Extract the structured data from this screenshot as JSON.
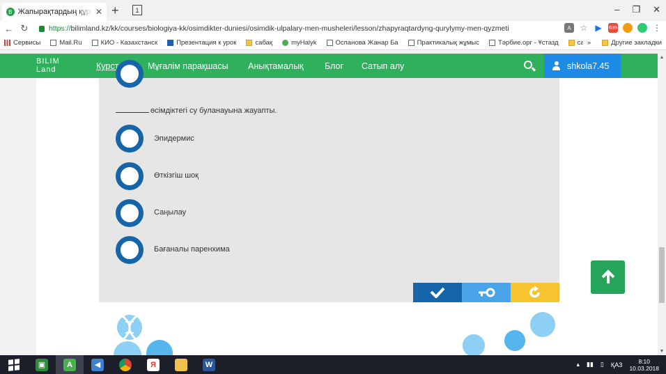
{
  "browser": {
    "tab_title": "Жапырақтардың құрылысы",
    "tab_count": "1",
    "url_scheme": "https://",
    "url_rest": "bilimland.kz/kk/courses/biologiya-kk/osimdikter-duniesi/osimdik-ulpalary-men-musheleri/lesson/zhapyraqtardyng-qurylymy-men-qyzmeti",
    "ext_badge": "639"
  },
  "bookmarks": {
    "items": [
      {
        "label": "Сервисы",
        "icon": "apps-icon"
      },
      {
        "label": "Mail.Ru",
        "icon": "page-icon"
      },
      {
        "label": "КИО - Казахстанск",
        "icon": "page-icon"
      },
      {
        "label": "Презентация к урок",
        "icon": "check-icon"
      },
      {
        "label": "сабақ",
        "icon": "folder-icon"
      },
      {
        "label": "myHalyk",
        "icon": "leaf-icon"
      },
      {
        "label": "Оспанова Жанар Ба",
        "icon": "page-icon"
      },
      {
        "label": "Практикалық жұмыс",
        "icon": "page-icon"
      },
      {
        "label": "Тәрбие.орг - Ұстазд",
        "icon": "page-icon"
      },
      {
        "label": "сад",
        "icon": "folder-icon"
      }
    ],
    "more": "»",
    "other": "Другие закладки"
  },
  "site": {
    "logo_line1": "BILIM",
    "logo_line2": "Land",
    "nav": [
      "Курстар",
      "Мұғалім парақшасы",
      "Анықтамалық",
      "Блог",
      "Сатып алу"
    ],
    "username": "shkola7.45"
  },
  "quiz": {
    "question_suffix": "өсімдіктегі су буланауына жауапты.",
    "answers": [
      "Эпидермис",
      "Өткізгіш шоқ",
      "Саңылау",
      "Бағаналы паренхима"
    ]
  },
  "taskbar": {
    "lang": "ҚАЗ",
    "time": "8:10",
    "date": "10.03.2018"
  },
  "colors": {
    "green": "#2fb05c",
    "blue": "#1565a8",
    "light_blue": "#4aa4e8",
    "yellow": "#f6c431"
  }
}
